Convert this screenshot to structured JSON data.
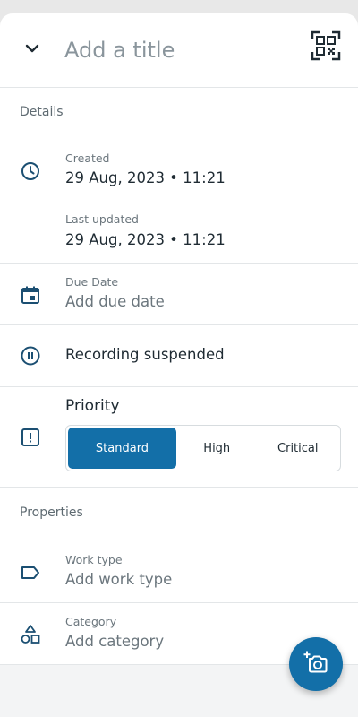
{
  "header": {
    "title_placeholder": "Add a title",
    "collapse_icon": "chevron-down-icon",
    "qr_icon": "qr-code-icon"
  },
  "details": {
    "section_label": "Details",
    "created": {
      "caption": "Created",
      "value": "29 Aug, 2023 • 11:21",
      "icon": "clock-icon"
    },
    "last_updated": {
      "caption": "Last updated",
      "value": "29 Aug, 2023 • 11:21"
    },
    "due_date": {
      "caption": "Due Date",
      "placeholder": "Add due date",
      "icon": "calendar-icon"
    },
    "recording": {
      "label": "Recording suspended",
      "icon": "pause-circle-icon"
    },
    "priority": {
      "label": "Priority",
      "icon": "priority-alert-icon",
      "options": [
        "Standard",
        "High",
        "Critical"
      ],
      "selected": "Standard"
    }
  },
  "properties": {
    "section_label": "Properties",
    "work_type": {
      "caption": "Work type",
      "placeholder": "Add work type",
      "icon": "label-tag-icon"
    },
    "category": {
      "caption": "Category",
      "placeholder": "Add category",
      "icon": "shapes-icon"
    }
  },
  "fab": {
    "icon": "add-photo-camera-icon"
  },
  "colors": {
    "accent": "#136fa8",
    "icon": "#1b4f72",
    "text_primary": "#1f2b33",
    "text_secondary": "#6b767d",
    "divider": "#e3e6e8"
  }
}
